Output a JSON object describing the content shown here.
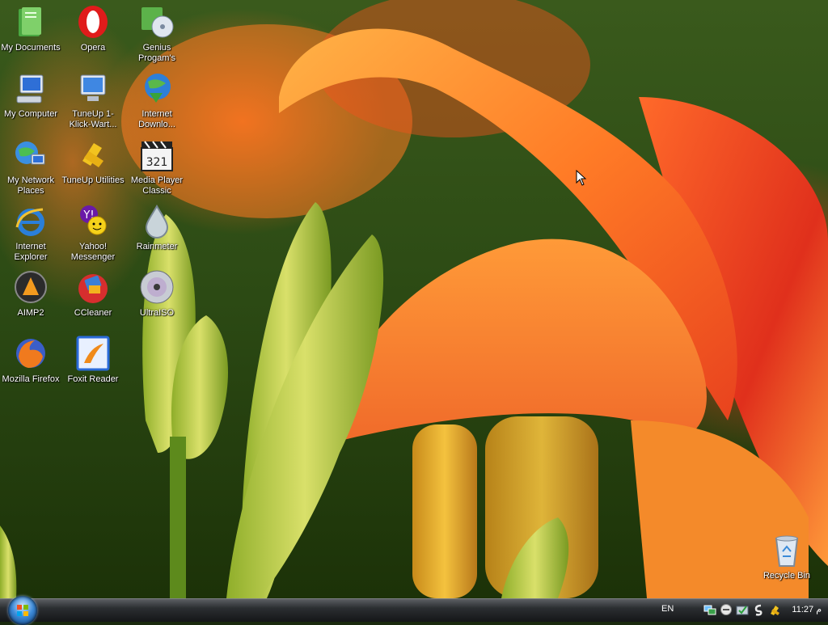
{
  "desktop": {
    "icons": [
      {
        "id": "my-documents",
        "label": "My Documents",
        "icon": "folder-documents-icon"
      },
      {
        "id": "opera",
        "label": "Opera",
        "icon": "opera-icon"
      },
      {
        "id": "genius-programs",
        "label": "Genius Progam's",
        "icon": "genius-programs-icon"
      },
      {
        "id": "my-computer",
        "label": "My Computer",
        "icon": "computer-icon"
      },
      {
        "id": "tuneup-1click",
        "label": "TuneUp 1-Klick-Wart...",
        "icon": "tuneup-monitor-icon"
      },
      {
        "id": "internet-download",
        "label": "Internet Downlo...",
        "icon": "internet-download-icon"
      },
      {
        "id": "my-network-places",
        "label": "My Network Places",
        "icon": "network-places-icon"
      },
      {
        "id": "tuneup-utilities",
        "label": "TuneUp Utilities",
        "icon": "tuneup-utilities-icon"
      },
      {
        "id": "media-player-classic",
        "label": "Media Player Classic",
        "icon": "clapperboard-icon"
      },
      {
        "id": "internet-explorer",
        "label": "Internet Explorer",
        "icon": "internet-explorer-icon"
      },
      {
        "id": "yahoo-messenger",
        "label": "Yahoo! Messenger",
        "icon": "yahoo-messenger-icon"
      },
      {
        "id": "rainmeter",
        "label": "Rainmeter",
        "icon": "droplet-icon"
      },
      {
        "id": "aimp2",
        "label": "AIMP2",
        "icon": "aimp-icon"
      },
      {
        "id": "ccleaner",
        "label": "CCleaner",
        "icon": "ccleaner-icon"
      },
      {
        "id": "ultraiso",
        "label": "UltraISO",
        "icon": "disc-icon"
      },
      {
        "id": "mozilla-firefox",
        "label": "Mozilla Firefox",
        "icon": "firefox-icon"
      },
      {
        "id": "foxit-reader",
        "label": "Foxit Reader",
        "icon": "foxit-reader-icon"
      },
      {
        "id": "recycle-bin",
        "label": "Recycle Bin",
        "icon": "recycle-bin-icon"
      }
    ]
  },
  "taskbar": {
    "start_icon": "windows-logo-icon",
    "language": "EN",
    "tray_icons": [
      "network-icon",
      "antivirus-icon",
      "security-check-icon",
      "update-icon",
      "utility-icon"
    ],
    "clock": "11:27 م"
  },
  "colors": {
    "taskbar_top": "#5c5f63",
    "taskbar_bottom": "#141618",
    "label_text": "#ffffff"
  }
}
